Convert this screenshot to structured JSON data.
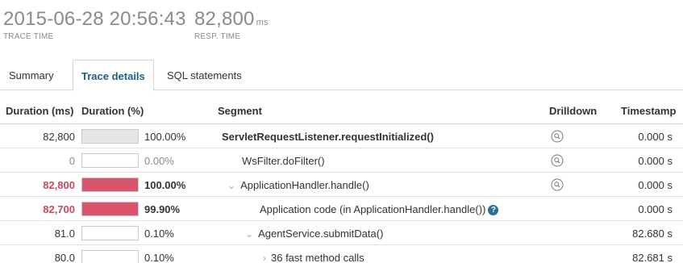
{
  "header": {
    "trace_time": {
      "value": "2015-06-28 20:56:43",
      "label": "TRACE TIME"
    },
    "resp_time": {
      "value": "82,800",
      "unit": "ms",
      "label": "RESP. TIME"
    }
  },
  "tabs": [
    {
      "label": "Summary",
      "active": false
    },
    {
      "label": "Trace details",
      "active": true
    },
    {
      "label": "SQL statements",
      "active": false
    }
  ],
  "columns": {
    "duration_ms": "Duration (ms)",
    "duration_pct": "Duration (%)",
    "segment": "Segment",
    "drilldown": "Drilldown",
    "timestamp": "Timestamp"
  },
  "rows": [
    {
      "ms": "82,800",
      "pct": "100.00%",
      "fraction": 1.0,
      "fill_color": "#e6e6e6",
      "segment": "ServletRequestListener.requestInitialized()",
      "timestamp": "0.000  s",
      "drilldown": true,
      "help": false
    },
    {
      "ms": "0",
      "pct": "0.00%",
      "fraction": 0.0,
      "fill_color": "#e6e6e6",
      "segment": "WsFilter.doFilter()",
      "timestamp": "0.000  s",
      "drilldown": true,
      "help": false
    },
    {
      "ms": "82,800",
      "pct": "100.00%",
      "fraction": 1.0,
      "fill_color": "#d9536a",
      "segment": "ApplicationHandler.handle()",
      "timestamp": "0.000  s",
      "drilldown": true,
      "help": false
    },
    {
      "ms": "82,700",
      "pct": "99.90%",
      "fraction": 0.999,
      "fill_color": "#d9536a",
      "segment": "Application code (in ApplicationHandler.handle())",
      "timestamp": "0.000  s",
      "drilldown": false,
      "help": true
    },
    {
      "ms": "81.0",
      "pct": "0.10%",
      "fraction": 0.001,
      "fill_color": "#e6e6e6",
      "segment": "AgentService.submitData()",
      "timestamp": "82.680  s",
      "drilldown": false,
      "help": false
    },
    {
      "ms": "80.0",
      "pct": "0.10%",
      "fraction": 0.001,
      "fill_color": "#e6e6e6",
      "segment": "36 fast method calls",
      "timestamp": "82.681  s",
      "drilldown": false,
      "help": false
    }
  ],
  "colors": {
    "accent": "#1c5f8f",
    "hot": "#d9536a",
    "help": "#2b6e97"
  }
}
